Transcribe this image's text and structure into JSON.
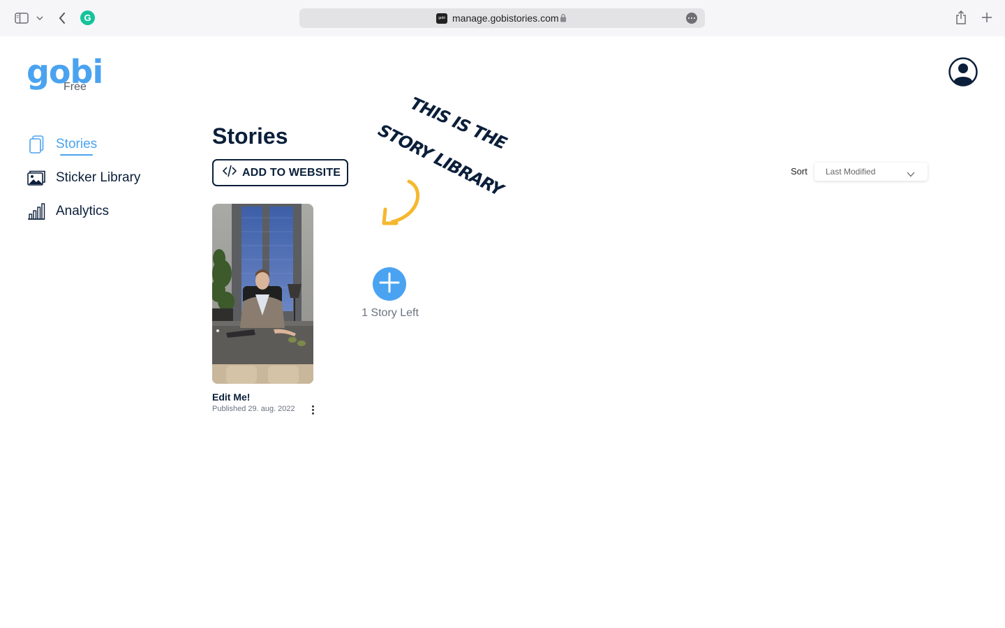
{
  "browser": {
    "url": "manage.gobistories.com",
    "favicon_text": "gobi",
    "grammarly_letter": "G"
  },
  "app": {
    "logo_text": "gobi",
    "plan": "Free"
  },
  "sidebar": {
    "items": [
      {
        "label": "Stories",
        "icon": "stories-icon",
        "active": true
      },
      {
        "label": "Sticker Library",
        "icon": "image-icon",
        "active": false
      },
      {
        "label": "Analytics",
        "icon": "bar-chart-icon",
        "active": false
      }
    ]
  },
  "main": {
    "title": "Stories",
    "add_button_label": "ADD TO WEBSITE",
    "sort": {
      "label": "Sort",
      "value": "Last Modified"
    },
    "stories": [
      {
        "title": "Edit Me!",
        "published": "Published 29. aug. 2022"
      }
    ],
    "new_story": {
      "remaining_label": "1 Story Left"
    },
    "annotation": {
      "line1": "THIS IS THE",
      "line2": "STORY LIBRARY"
    }
  },
  "colors": {
    "brand_blue": "#4aa3f0",
    "navy": "#0b1f3a",
    "arrow_yellow": "#f5b82e"
  }
}
